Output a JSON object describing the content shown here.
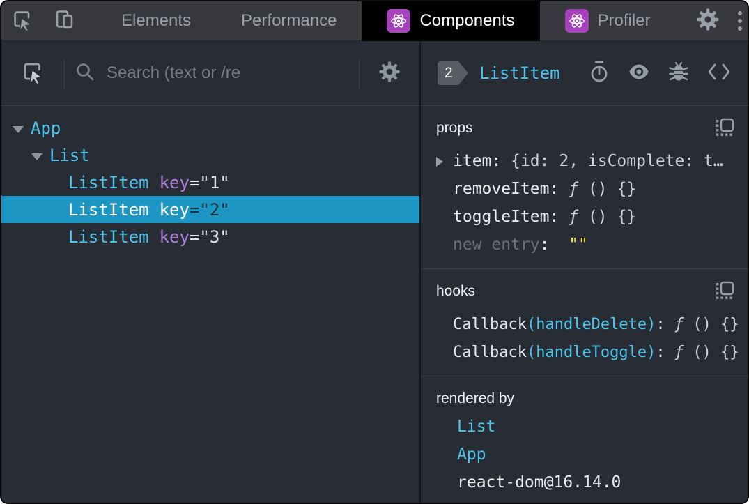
{
  "tabbar": {
    "tabs": [
      {
        "label": "Elements"
      },
      {
        "label": "Performance"
      },
      {
        "label": "Components"
      },
      {
        "label": "Profiler"
      }
    ],
    "icons": {
      "inspect": "inspect-element-icon",
      "device": "device-toolbar-icon",
      "react": "react-atom-icon",
      "settings": "gear-icon",
      "menu": "kebab-menu-icon"
    }
  },
  "colors": {
    "accent_cyan": "#4fc3ea",
    "attr_purple": "#ad7fd6",
    "selection_blue": "#1e96c3",
    "react_purple": "#a743bd",
    "string_yellow": "#ece23a",
    "panel_bg": "#272c35",
    "tabbar_bg": "#36383d"
  },
  "left_panel": {
    "search": {
      "placeholder": "Search (text or /re"
    },
    "tree": {
      "rows": [
        {
          "name": "App"
        },
        {
          "name": "List"
        },
        {
          "name": "ListItem",
          "attr": "key",
          "eq_value": "=\"1\""
        },
        {
          "name": "ListItem",
          "attr": "key",
          "eq_value": "=\"2\""
        },
        {
          "name": "ListItem",
          "attr": "key",
          "eq_value": "=\"3\""
        }
      ]
    }
  },
  "right_panel": {
    "header": {
      "badge": "2",
      "title": "ListItem"
    },
    "props": {
      "title": "props",
      "rows": [
        {
          "key": "item",
          "sep": ":",
          "value": "{id: 2, isComplete: t…"
        },
        {
          "key": "removeItem",
          "sep": ":",
          "fn": "ƒ",
          "fn_rest": " () {}"
        },
        {
          "key": "toggleItem",
          "sep": ":",
          "fn": "ƒ",
          "fn_rest": " () {}"
        },
        {
          "key": "new entry",
          "sep": ":",
          "value": "\"\""
        }
      ]
    },
    "hooks": {
      "title": "hooks",
      "rows": [
        {
          "label": "Callback",
          "paren": "(handleDelete)",
          "sep": ":",
          "fn": " ƒ",
          "fn_rest": " () {}"
        },
        {
          "label": "Callback",
          "paren": "(handleToggle)",
          "sep": ":",
          "fn": " ƒ",
          "fn_rest": " () {}"
        }
      ]
    },
    "rendered_by": {
      "title": "rendered by",
      "rows": [
        {
          "label": "List"
        },
        {
          "label": "App"
        },
        {
          "label": "react-dom@16.14.0"
        }
      ]
    }
  }
}
